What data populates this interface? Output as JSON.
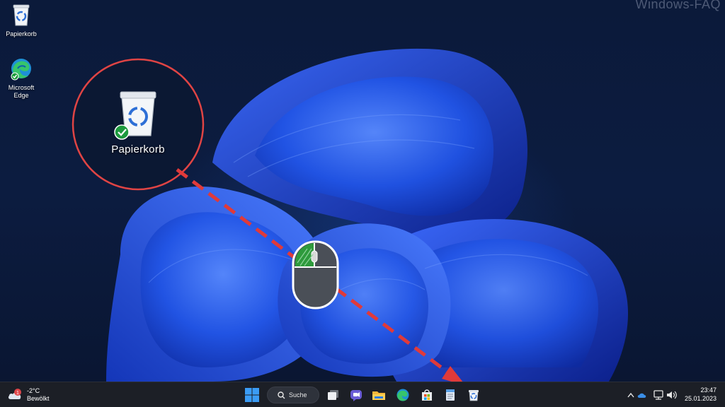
{
  "watermark": "Windows-FAQ",
  "desktop": {
    "icons": [
      {
        "label": "Papierkorb"
      },
      {
        "label_line1": "Microsoft",
        "label_line2": "Edge"
      }
    ],
    "zoom_callout": {
      "label": "Papierkorb"
    }
  },
  "taskbar": {
    "weather": {
      "badge": "1",
      "temp": "-2°C",
      "condition": "Bewölkt"
    },
    "search": {
      "label": "Suche"
    },
    "clock": {
      "time": "23:47",
      "date": "25.01.2023"
    }
  },
  "colors": {
    "accent": "#3a7be0",
    "annotation_red": "#e03a3a",
    "mouse_green": "#2e9a3c",
    "taskbar_bg": "#1c1f26"
  }
}
